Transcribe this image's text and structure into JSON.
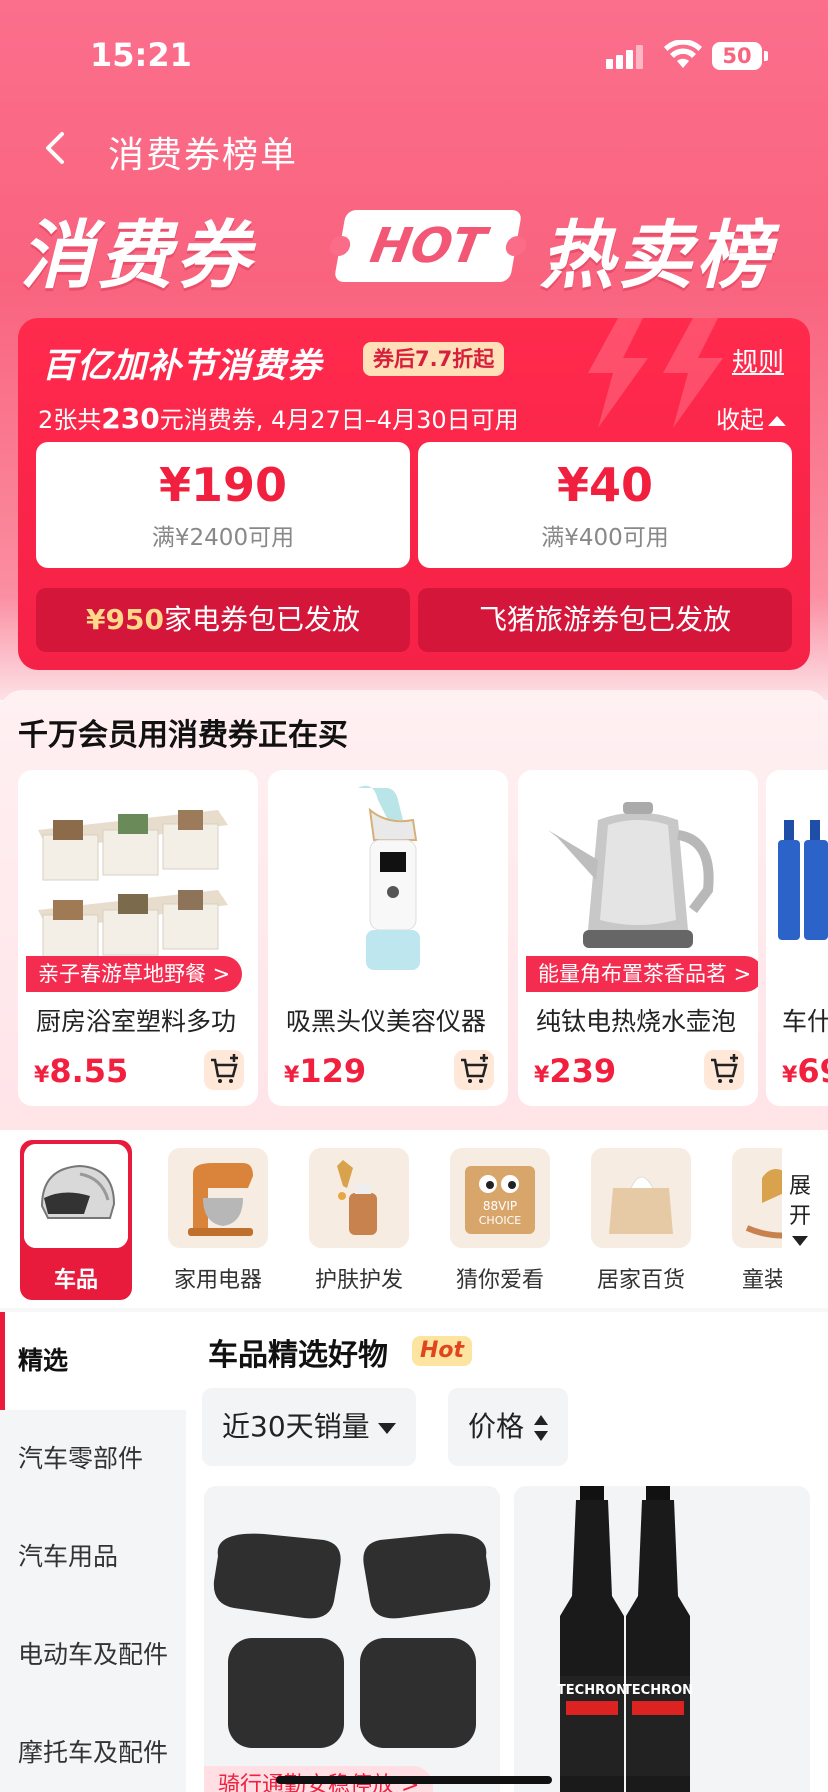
{
  "status_bar": {
    "time": "15:21",
    "battery": "50"
  },
  "header": {
    "title": "消费券榜单"
  },
  "banner": {
    "left_text": "消费券",
    "hot_text": "HOT",
    "right_text": "热卖榜"
  },
  "coupon_card": {
    "heading": "百亿加补节消费券",
    "badge": "券后7.7折起",
    "rules_label": "规则",
    "info_prefix": "2张共",
    "info_amount": "230",
    "info_suffix": "元消费券, 4月27日–4月30日可用",
    "collapse_label": "收起",
    "vouchers": [
      {
        "value": "¥190",
        "condition": "满¥2400可用"
      },
      {
        "value": "¥40",
        "condition": "满¥400可用"
      }
    ],
    "packs": [
      {
        "highlight": "¥950",
        "text": "家电券包已发放"
      },
      {
        "highlight": "",
        "text": "飞猪旅游券包已发放"
      }
    ]
  },
  "members": {
    "title": "千万会员用消费券正在买",
    "products": [
      {
        "tag": "亲子春游草地野餐 >",
        "name": "厨房浴室塑料多功",
        "currency": "¥",
        "price": "8.55"
      },
      {
        "tag": "",
        "name": "吸黑头仪美容仪器",
        "currency": "¥",
        "price": "129"
      },
      {
        "tag": "能量角布置茶香品茗 >",
        "name": "纯钛电热烧水壶泡",
        "currency": "¥",
        "price": "239"
      },
      {
        "tag": "",
        "name": "车什",
        "currency": "¥",
        "price": "69"
      }
    ]
  },
  "categories": {
    "items": [
      {
        "label": "车品",
        "active": true
      },
      {
        "label": "家用电器",
        "active": false
      },
      {
        "label": "护肤护发",
        "active": false
      },
      {
        "label": "猜你爱看",
        "active": false,
        "img_text": "88VIP CHOICE"
      },
      {
        "label": "居家百货",
        "active": false
      },
      {
        "label": "童装",
        "active": false
      }
    ],
    "expand_label": "展开"
  },
  "side_nav": [
    "精选",
    "汽车零部件",
    "汽车用品",
    "电动车及配件",
    "摩托车及配件"
  ],
  "main_list": {
    "section_title": "车品精选好物",
    "hot_badge": "Hot",
    "sort_sales": "近30天销量",
    "sort_price": "价格",
    "cards": [
      {
        "tag": "骑行通勤安稳停放 >"
      },
      {
        "tag": ""
      }
    ]
  }
}
